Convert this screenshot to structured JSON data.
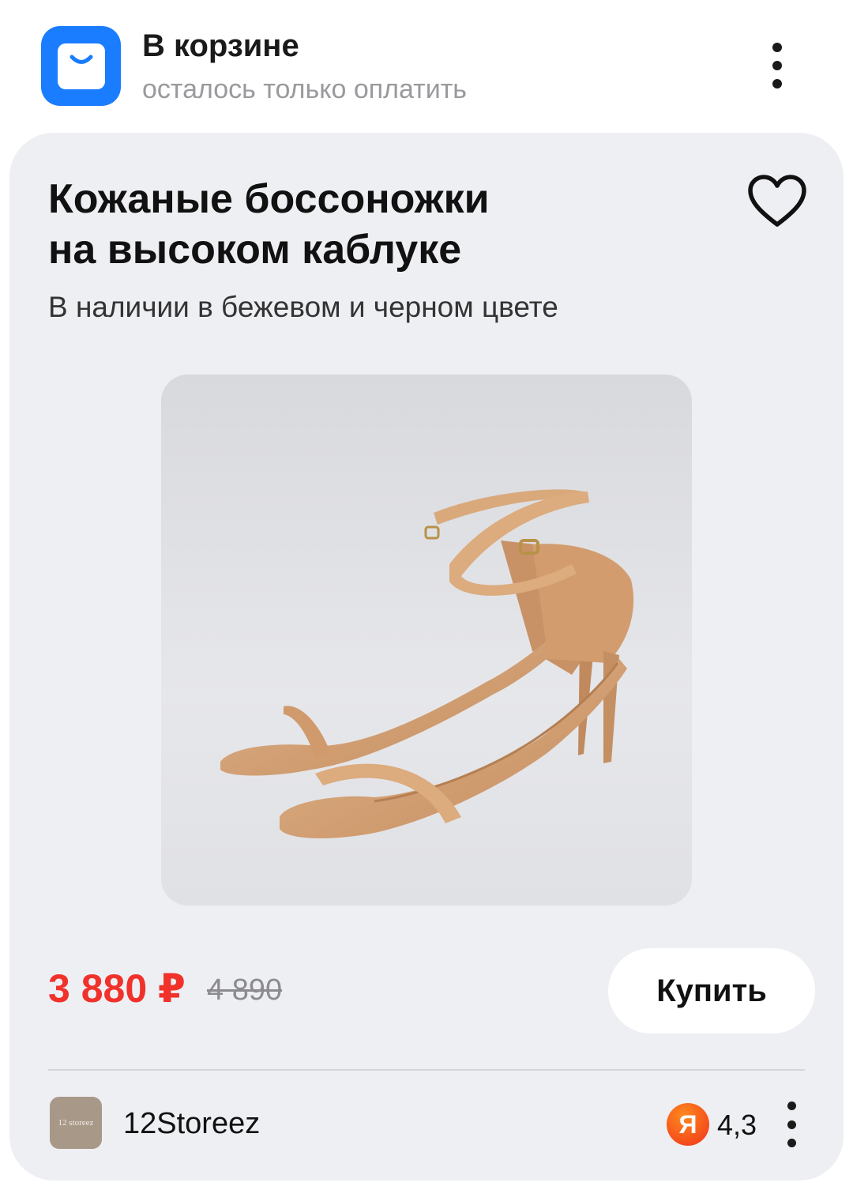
{
  "header": {
    "title": "В корзине",
    "subtitle": "осталось только оплатить",
    "app_icon": "shopping-bag-icon",
    "accent_color": "#1a7cff"
  },
  "product": {
    "title_line1": "Кожаные боссоножки",
    "title_line2": "на высоком каблуке",
    "description": "В наличии в бежевом и черном цвете",
    "favorite_icon": "heart-icon",
    "image": "beige-heeled-sandals-photo"
  },
  "price": {
    "current": "3 880 ₽",
    "old": "4 890",
    "current_color": "#f0322b"
  },
  "buy_button": {
    "label": "Купить"
  },
  "seller": {
    "name": "12Storeez",
    "logo_text": "12 storeez",
    "rating_badge": "Я",
    "rating": "4,3"
  }
}
